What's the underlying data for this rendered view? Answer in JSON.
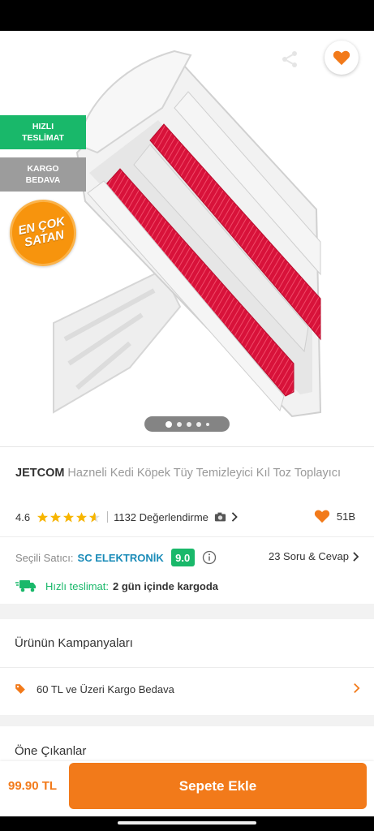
{
  "header": {
    "back_icon": "arrow-left-icon",
    "share_icon": "share-icon",
    "favorite_icon": "heart-icon"
  },
  "badges": {
    "fast_delivery": [
      "HIZLI",
      "TESLİMAT"
    ],
    "free_cargo": [
      "KARGO",
      "BEDAVA"
    ],
    "best_seller": [
      "EN ÇOK",
      "SATAN"
    ]
  },
  "gallery": {
    "image_count": 5,
    "active_index": 0
  },
  "product": {
    "brand": "JETCOM",
    "name": "Hazneli Kedi Köpek Tüy Temizleyici Kıl Toz Toplayıcı",
    "rating": "4.6",
    "rating_value": 4.6,
    "review_count_text": "1132 Değerlendirme",
    "favorites_count": "51B"
  },
  "seller": {
    "label": "Seçili Satıcı:",
    "name": "SC ELEKTRONİK",
    "score": "9.0",
    "qa_text": "23 Soru & Cevap"
  },
  "shipping": {
    "label": "Hızlı teslimat:",
    "value": "2 gün içinde kargoda"
  },
  "campaigns": {
    "title": "Ürünün Kampanyaları",
    "items": [
      {
        "text": "60 TL ve Üzeri Kargo Bedava"
      }
    ]
  },
  "highlights": {
    "title": "Öne Çıkanlar"
  },
  "bottom": {
    "price": "99.90 TL",
    "add_to_cart": "Sepete Ekle"
  },
  "colors": {
    "accent": "#f27a1a",
    "green": "#19b86a",
    "seller_blue": "#1a8bb8",
    "cargo_gray": "#9c9c9c"
  }
}
